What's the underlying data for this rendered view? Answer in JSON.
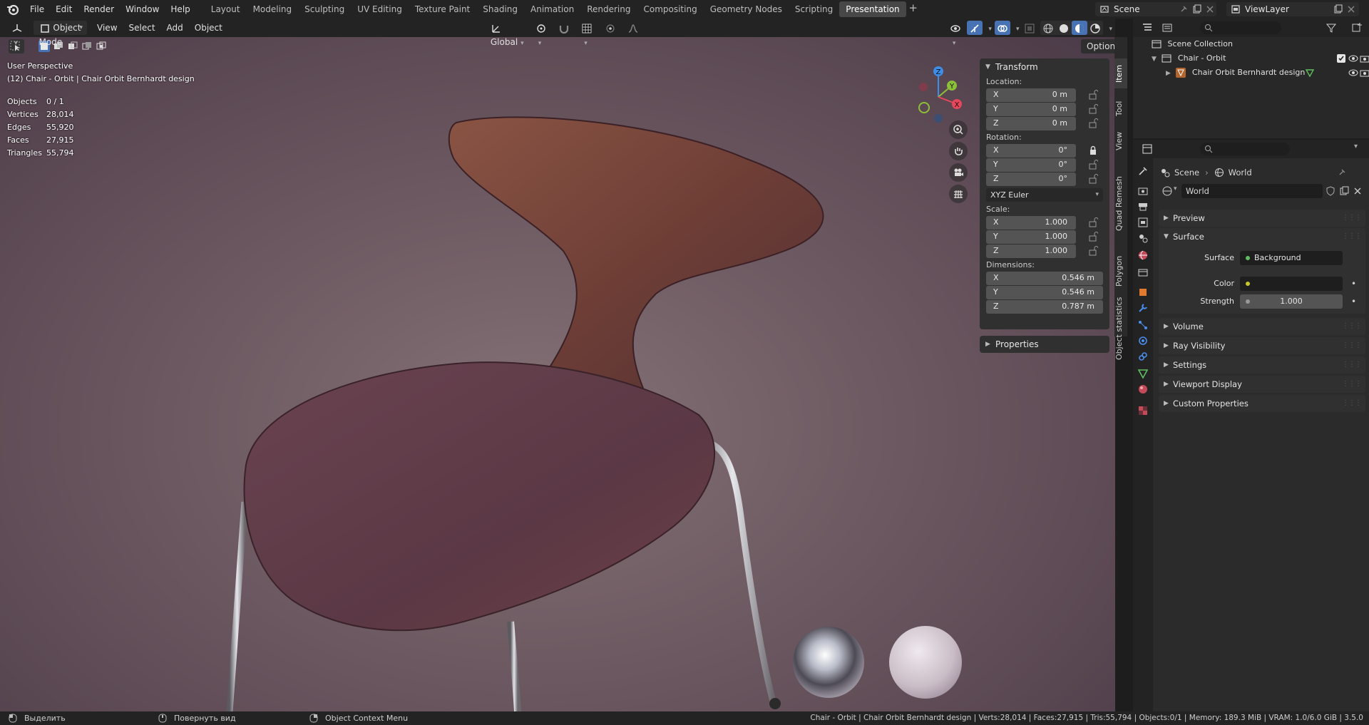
{
  "menu": [
    "File",
    "Edit",
    "Render",
    "Window",
    "Help"
  ],
  "workspaces": {
    "tabs": [
      "Layout",
      "Modeling",
      "Sculpting",
      "UV Editing",
      "Texture Paint",
      "Shading",
      "Animation",
      "Rendering",
      "Compositing",
      "Geometry Nodes",
      "Scripting",
      "Presentation"
    ],
    "active": "Presentation"
  },
  "scene": "Scene",
  "view_layer": "ViewLayer",
  "viewport_header": {
    "mode": "Object Mode",
    "menus": [
      "View",
      "Select",
      "Add",
      "Object"
    ],
    "orientation": "Global",
    "options": "Options"
  },
  "overlay": {
    "perspective": "User Perspective",
    "object_info": "(12) Chair - Orbit | Chair Orbit Bernhardt design",
    "stats": [
      {
        "label": "Objects",
        "value": "0 / 1"
      },
      {
        "label": "Vertices",
        "value": "28,014"
      },
      {
        "label": "Edges",
        "value": "55,920"
      },
      {
        "label": "Faces",
        "value": "27,915"
      },
      {
        "label": "Triangles",
        "value": "55,794"
      }
    ]
  },
  "gizmo": {
    "z": "Z",
    "y": "Y",
    "x": "X"
  },
  "npanel": {
    "tabs": [
      "Item",
      "Tool",
      "View",
      "Quad Remesh",
      "Polygon",
      "Object statistics"
    ],
    "transform_title": "Transform",
    "location_label": "Location:",
    "location": [
      {
        "axis": "X",
        "value": "0 m"
      },
      {
        "axis": "Y",
        "value": "0 m"
      },
      {
        "axis": "Z",
        "value": "0 m"
      }
    ],
    "rotation_label": "Rotation:",
    "rotation": [
      {
        "axis": "X",
        "value": "0°"
      },
      {
        "axis": "Y",
        "value": "0°"
      },
      {
        "axis": "Z",
        "value": "0°"
      }
    ],
    "rotation_mode": "XYZ Euler",
    "scale_label": "Scale:",
    "scale": [
      {
        "axis": "X",
        "value": "1.000"
      },
      {
        "axis": "Y",
        "value": "1.000"
      },
      {
        "axis": "Z",
        "value": "1.000"
      }
    ],
    "dimensions_label": "Dimensions:",
    "dimensions": [
      {
        "axis": "X",
        "value": "0.546 m"
      },
      {
        "axis": "Y",
        "value": "0.546 m"
      },
      {
        "axis": "Z",
        "value": "0.787 m"
      }
    ],
    "properties_title": "Properties"
  },
  "outliner": {
    "root": "Scene Collection",
    "collection": "Chair - Orbit",
    "object": "Chair Orbit Bernhardt design"
  },
  "properties": {
    "breadcrumb": [
      "Scene",
      "World"
    ],
    "world_name": "World",
    "panels": {
      "preview": "Preview",
      "surface": "Surface",
      "volume": "Volume",
      "ray_visibility": "Ray Visibility",
      "settings": "Settings",
      "viewport_display": "Viewport Display",
      "custom_properties": "Custom Properties"
    },
    "surface_label": "Surface",
    "surface_value": "Background",
    "color_label": "Color",
    "strength_label": "Strength",
    "strength_value": "1.000"
  },
  "status": {
    "left1": "Выделить",
    "left2": "Повернуть вид",
    "left3": "Object Context Menu",
    "right": "Chair - Orbit | Chair Orbit Bernhardt design | Verts:28,014 | Faces:27,915 | Tris:55,794 | Objects:0/1 | Memory: 189.3 MiB | VRAM: 1.0/6.0 GiB | 3.5.0"
  },
  "colors": {
    "accent": "#4772b3",
    "axis_x": "#e8465a",
    "axis_y": "#8cbf3a",
    "axis_z": "#3d8ee8"
  }
}
